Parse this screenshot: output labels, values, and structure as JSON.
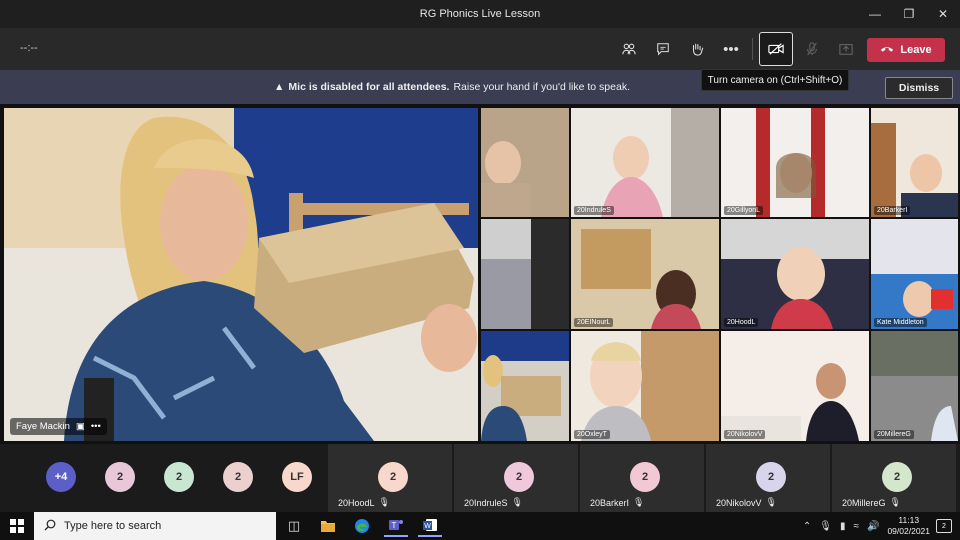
{
  "window": {
    "title": "RG Phonics Live Lesson",
    "minimize_icon": "minimize-icon",
    "restore_icon": "restore-icon",
    "close_icon": "close-icon"
  },
  "toolbar": {
    "timer": "--:--",
    "leave_label": "Leave",
    "leave_color": "#c4314b",
    "icons": [
      "people-icon",
      "chat-icon",
      "raise-hand-icon",
      "more-icon",
      "camera-off-icon",
      "mic-disabled-icon",
      "share-tray-icon"
    ]
  },
  "tooltip": {
    "text": "Turn camera on (Ctrl+Shift+O)"
  },
  "notice": {
    "bold": "Mic is disabled for all attendees.",
    "text": "Raise your hand if you'd like to speak.",
    "dismiss_label": "Dismiss"
  },
  "presenter": {
    "name": "Faye Mackin"
  },
  "grid_tiles": [
    {
      "label": ""
    },
    {
      "label": "20IndruleS"
    },
    {
      "label": "20GillyonL"
    },
    {
      "label": "20BarkerI"
    },
    {
      "label": ""
    },
    {
      "label": "20EINourL"
    },
    {
      "label": "20HoodL"
    },
    {
      "label": "Kate Middleton"
    },
    {
      "label": ""
    },
    {
      "label": "20OxleyT"
    },
    {
      "label": "20NikolovV"
    },
    {
      "label": "20MillereG"
    }
  ],
  "people_bar": {
    "overflow": "+4",
    "avatars": [
      {
        "text": "2",
        "color": "#e8c8d8"
      },
      {
        "text": "2",
        "color": "#c8e6d2"
      },
      {
        "text": "2",
        "color": "#ecd0d0"
      },
      {
        "text": "LF",
        "color": "#f8d8cc"
      }
    ],
    "tiles": [
      {
        "avatar": "2",
        "name": "20HoodL",
        "color": "#f8d8cc"
      },
      {
        "avatar": "2",
        "name": "20IndruleS",
        "color": "#f0c8dc"
      },
      {
        "avatar": "2",
        "name": "20BarkerI",
        "color": "#f2c8d4"
      },
      {
        "avatar": "2",
        "name": "20NikolovV",
        "color": "#d8d4ec"
      },
      {
        "avatar": "2",
        "name": "20MillereG",
        "color": "#d4e6cc"
      }
    ]
  },
  "taskbar": {
    "search_placeholder": "Type here to search",
    "time": "11:13",
    "date": "09/02/2021",
    "notifications": "2"
  }
}
